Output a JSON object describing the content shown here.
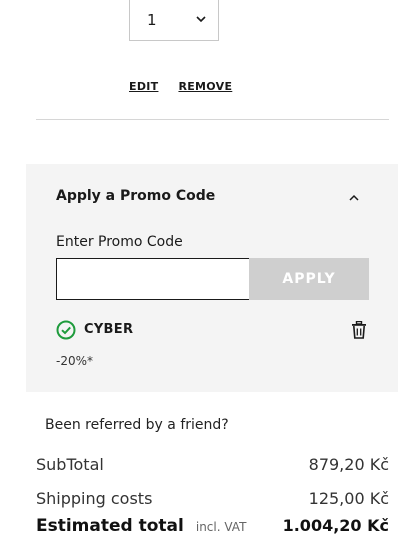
{
  "item": {
    "quantity": "1",
    "edit_label": "EDIT",
    "remove_label": "REMOVE"
  },
  "promo": {
    "title": "Apply a Promo Code",
    "input_label": "Enter Promo Code",
    "input_value": "",
    "apply_label": "APPLY",
    "applied_code": "CYBER",
    "discount": "-20%*",
    "colors": {
      "success": "#1e9b3c",
      "apply_disabled": "#cfcfcf",
      "panel_bg": "#f4f4f4"
    }
  },
  "referral": {
    "text": "Been referred by a friend?"
  },
  "summary": {
    "subtotal_label": "SubTotal",
    "subtotal_value": "879,20 Kč",
    "shipping_label": "Shipping costs",
    "shipping_value": "125,00 Kč",
    "total_label": "Estimated total",
    "vat_note": "incl. VAT",
    "total_value": "1.004,20 Kč"
  }
}
